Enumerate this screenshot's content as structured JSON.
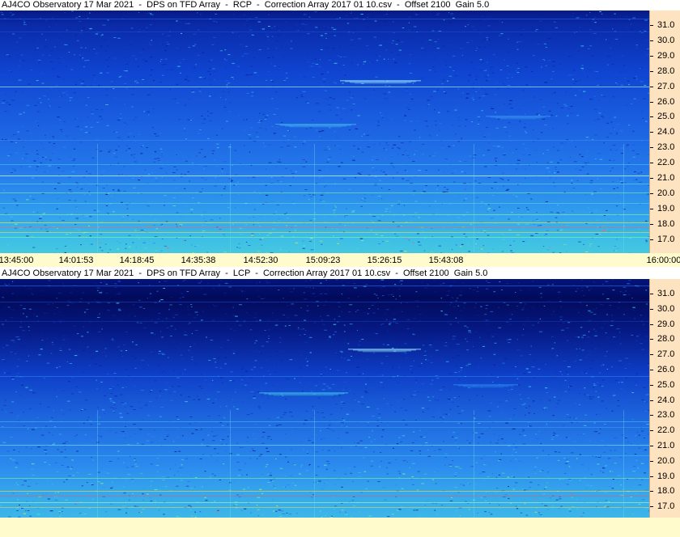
{
  "panels": [
    {
      "title": "AJ4CO Observatory 17 Mar 2021  -  DPS on TFD Array  -  RCP  -  Correction Array 2017 01 10.csv  -  Offset 2100  Gain 5.0",
      "polarization": "RCP",
      "freq_ticks": [
        "31.0",
        "30.0",
        "29.0",
        "28.0",
        "27.0",
        "26.0",
        "25.0",
        "24.0",
        "23.0",
        "22.0",
        "21.0",
        "20.0",
        "19.0",
        "18.0",
        "17.0"
      ]
    },
    {
      "title": "AJ4CO Observatory 17 Mar 2021  -  DPS on TFD Array  -  LCP  -  Correction Array 2017 01 10.csv  -  Offset 2100  Gain 5.0",
      "polarization": "LCP",
      "freq_ticks": [
        "31.0",
        "30.0",
        "29.0",
        "28.0",
        "27.0",
        "26.0",
        "25.0",
        "24.0",
        "23.0",
        "22.0",
        "21.0",
        "20.0",
        "19.0",
        "18.0",
        "17.0"
      ]
    }
  ],
  "time_ticks": [
    "13:45:00",
    "14:01:53",
    "14:18:45",
    "14:35:38",
    "14:52:30",
    "15:09:23",
    "15:26:15",
    "15:43:08",
    "16:00:00"
  ],
  "chart_data": [
    {
      "type": "heatmap",
      "title": "AJ4CO Observatory 17 Mar 2021  -  DPS on TFD Array  -  RCP  -  Correction Array 2017 01 10.csv  -  Offset 2100  Gain 5.0",
      "x_ticks": [
        "13:45:00",
        "14:01:53",
        "14:18:45",
        "14:35:38",
        "14:52:30",
        "15:09:23",
        "15:26:15",
        "15:43:08",
        "16:00:00"
      ],
      "x_range": [
        "13:45:00",
        "16:00:00"
      ],
      "y_ticks": [
        31.0,
        30.0,
        29.0,
        28.0,
        27.0,
        26.0,
        25.0,
        24.0,
        23.0,
        22.0,
        21.0,
        20.0,
        19.0,
        18.0,
        17.0
      ],
      "y_range": [
        16.5,
        31.7
      ],
      "colormap": [
        "#000a55",
        "#0a2ab0",
        "#1e5ae6",
        "#2a8af0",
        "#3ec8e8",
        "#7cf0a0",
        "#f0e040",
        "#ff4040"
      ]
    },
    {
      "type": "heatmap",
      "title": "AJ4CO Observatory 17 Mar 2021  -  DPS on TFD Array  -  LCP  -  Correction Array 2017 01 10.csv  -  Offset 2100  Gain 5.0",
      "x_ticks": [
        "13:45:00",
        "14:01:53",
        "14:18:45",
        "14:35:38",
        "14:52:30",
        "15:09:23",
        "15:26:15",
        "15:43:08",
        "16:00:00"
      ],
      "x_range": [
        "13:45:00",
        "16:00:00"
      ],
      "y_ticks": [
        31.0,
        30.0,
        29.0,
        28.0,
        27.0,
        26.0,
        25.0,
        24.0,
        23.0,
        22.0,
        21.0,
        20.0,
        19.0,
        18.0,
        17.0
      ],
      "y_range": [
        16.5,
        31.7
      ],
      "colormap": [
        "#000a55",
        "#0a2ab0",
        "#1e5ae6",
        "#2a8af0",
        "#3ec8e8",
        "#7cf0a0",
        "#f0e040",
        "#ff4040"
      ]
    }
  ]
}
